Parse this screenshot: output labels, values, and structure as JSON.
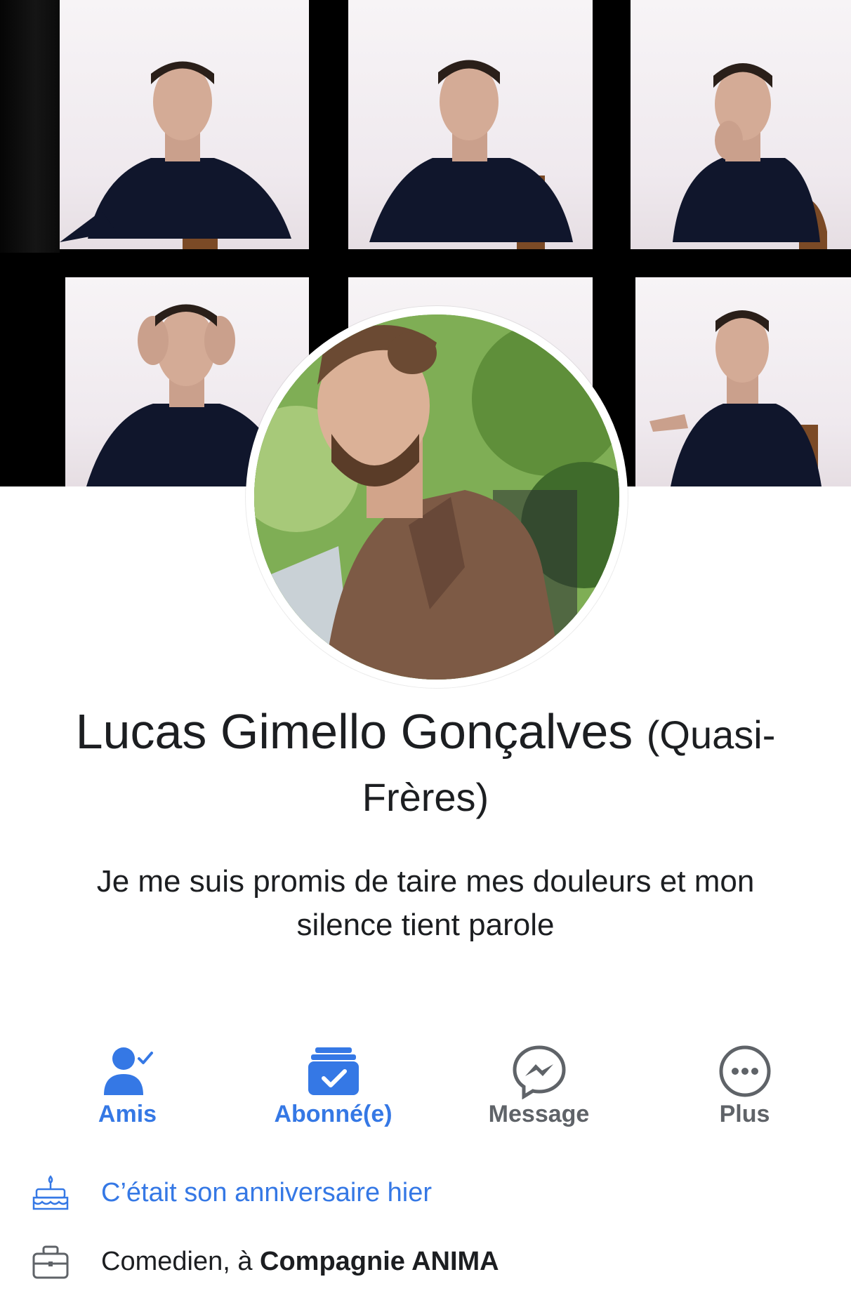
{
  "profile": {
    "name": "Lucas Gimello Gonçalves",
    "alternate_name": "(Quasi-Frères)",
    "bio": "Je me suis promis de taire mes douleurs et mon silence tient parole"
  },
  "actions": [
    {
      "label": "Amis",
      "icon": "friends-check-icon",
      "color": "#3578e5"
    },
    {
      "label": "Abonné(e)",
      "icon": "following-check-icon",
      "color": "#3578e5"
    },
    {
      "label": "Message",
      "icon": "messenger-icon",
      "color": "#5f6368"
    },
    {
      "label": "Plus",
      "icon": "more-icon",
      "color": "#5f6368"
    }
  ],
  "info": {
    "birthday": "C’était son anniversaire hier",
    "work_prefix": "Comedien, à ",
    "work_place": "Compagnie ANIMA"
  },
  "colors": {
    "accent": "#3578e5",
    "text": "#1c1e21",
    "muted": "#5f6368"
  }
}
